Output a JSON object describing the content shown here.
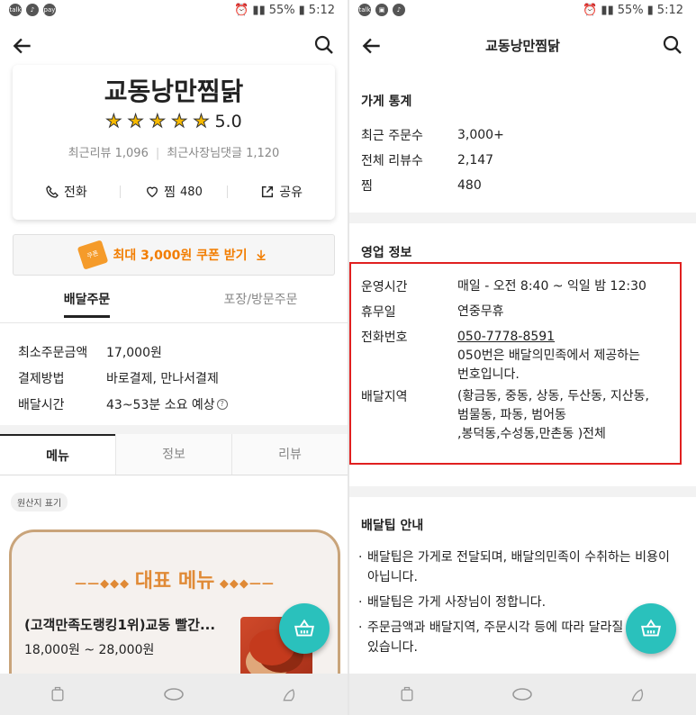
{
  "status_left": {
    "time": "5:12",
    "battery": "55%"
  },
  "status_right": {
    "time": "5:12",
    "battery": "55%"
  },
  "left": {
    "store_name": "교동낭만찜닭",
    "rating": "5.0",
    "recent_review": "최근리뷰 1,096",
    "recent_owner_comments": "최근사장님댓글 1,120",
    "call_label": "전화",
    "like_label": "찜",
    "like_count": "480",
    "share_label": "공유",
    "coupon_label": "최대 3,000원 쿠폰 받기",
    "order_tabs": [
      "배달주문",
      "포장/방문주문"
    ],
    "info": [
      {
        "key": "최소주문금액",
        "value": "17,000원"
      },
      {
        "key": "결제방법",
        "value": "바로결제, 만나서결제"
      },
      {
        "key": "배달시간",
        "value": "43~53분 소요 예상"
      }
    ],
    "menu_tabs": [
      "메뉴",
      "정보",
      "리뷰"
    ],
    "origin_label": "원산지 표기",
    "menu_header": "대표 메뉴",
    "menu_item_name": "(고객만족도랭킹1위)교동 빨간...",
    "menu_item_price": "18,000원 ~ 28,000원"
  },
  "right": {
    "title": "교동낭만찜닭",
    "stats_title": "가게 통계",
    "stats": [
      {
        "key": "최근 주문수",
        "value": "3,000+"
      },
      {
        "key": "전체 리뷰수",
        "value": "2,147"
      },
      {
        "key": "찜",
        "value": "480"
      }
    ],
    "biz_title": "영업 정보",
    "hours_key": "운영시간",
    "hours_value": "매일 - 오전 8:40 ~ 익일 밤 12:30",
    "holiday_key": "휴무일",
    "holiday_value": "연중무휴",
    "phone_key": "전화번호",
    "phone_value": "050-7778-8591",
    "phone_note_1": "050번은 배달의민족에서 제공하는",
    "phone_note_2": "번호입니다.",
    "area_key": "배달지역",
    "area_1": "(황금동, 중동, 상동, 두산동, 지산동,",
    "area_2": "범물동, 파동, 범어동",
    "area_3": ",봉덕동,수성동,만촌동 )전체",
    "tip_title": "배달팁 안내",
    "tip_1a": "배달팁은 가게로 전달되며, 배달의민족이 수취하는 비용이",
    "tip_1b": "아닙니다.",
    "tip_2": "배달팁은 가게 사장님이 정합니다.",
    "tip_3a": "주문금액과 배달지역, 주문시각 등에 따라 달라질 수",
    "tip_3b": "있습니다."
  },
  "colors": {
    "accent": "#2ac1bc",
    "coupon": "#f27d00",
    "highlight_box": "#e02020",
    "menu_border": "#c9a47a"
  }
}
